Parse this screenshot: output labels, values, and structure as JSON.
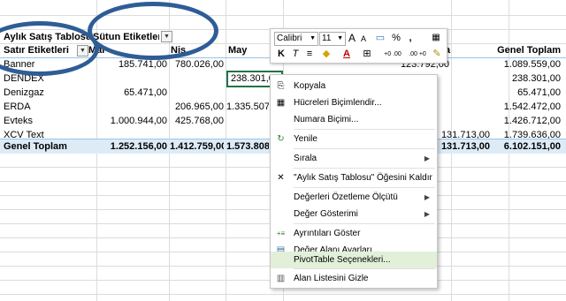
{
  "pivot": {
    "title": "Aylık Satış Tablosu",
    "column_labels_header": "Sütun Etiketleri",
    "row_labels_header": "Satır Etiketleri",
    "months": [
      "Mar",
      "Nis",
      "May"
    ],
    "partial_header": "a",
    "grand_total_header": "Genel Toplam",
    "rows": [
      {
        "name": "Banner",
        "c1": "185.741,00",
        "c2": "780.026,00",
        "c3": "",
        "c4": "123.792,00",
        "total": "1.089.559,00"
      },
      {
        "name": "DENDEX",
        "c1": "",
        "c2": "",
        "c3": "238.301,00",
        "c4": "",
        "total": "238.301,00"
      },
      {
        "name": "Denizgaz",
        "c1": "65.471,00",
        "c2": "",
        "c3": "",
        "c4": "",
        "total": "65.471,00"
      },
      {
        "name": "ERDA",
        "c1": "",
        "c2": "206.965,00",
        "c3": "1.335.507,",
        "c4": "",
        "total": "1.542.472,00"
      },
      {
        "name": "Evteks",
        "c1": "1.000.944,00",
        "c2": "425.768,00",
        "c3": "",
        "c4": "",
        "total": "1.426.712,00"
      },
      {
        "name": "XCV Text",
        "c1": "",
        "c2": "",
        "c3": "",
        "c4": "131.713,00",
        "total": "1.739.636,00"
      }
    ],
    "grand_total": {
      "name": "Genel Toplam",
      "c1": "1.252.156,00",
      "c2": "1.412.759,00",
      "c3": "1.573.808,",
      "c4": "131.713,00",
      "total": "6.102.151,00"
    }
  },
  "mini_toolbar": {
    "font_name": "Calibri",
    "font_size": "11",
    "grow_font": "A",
    "shrink_font": "A",
    "percent": "%",
    "thousands": ",",
    "bold": "K",
    "italic": "T",
    "align": "≡",
    "font_color": "A",
    "dec_increase": "+0 .00",
    "dec_decrease": ".00 +0"
  },
  "context_menu": {
    "items": [
      {
        "label": "Kopyala",
        "icon": "copy-icon",
        "glyph": "⎘"
      },
      {
        "label": "Hücreleri Biçimlendir...",
        "icon": "format-cells-icon",
        "glyph": "▦"
      },
      {
        "label": "Numara Biçimi...",
        "icon": "",
        "glyph": ""
      },
      {
        "label": "Yenile",
        "icon": "refresh-icon",
        "glyph": "↻"
      },
      {
        "label": "Sırala",
        "icon": "",
        "glyph": "",
        "submenu": "▶"
      },
      {
        "label": "\"Aylık Satış Tablosu\" Öğesini Kaldır",
        "icon": "remove-x-icon",
        "glyph": "✕"
      },
      {
        "label": "Değerleri Özetleme Ölçütü",
        "icon": "",
        "glyph": "",
        "submenu": "▶"
      },
      {
        "label": "Değer Gösterimi",
        "icon": "",
        "glyph": "",
        "submenu": "▶"
      },
      {
        "label": "Ayrıntıları Göster",
        "icon": "show-details-icon",
        "glyph": "+≡"
      },
      {
        "label": "Değer Alanı Ayarları...",
        "icon": "field-settings-icon",
        "glyph": "▤"
      },
      {
        "label": "PivotTable Seçenekleri...",
        "icon": "",
        "glyph": ""
      },
      {
        "label": "Alan Listesini Gizle",
        "icon": "field-list-icon",
        "glyph": "▥"
      }
    ]
  },
  "colors": {
    "annotation_ring": "#2e5d96",
    "total_row_fill": "#ddebf7",
    "menu_highlight": "#e2f0d9",
    "selected_cell_border": "#217346"
  }
}
